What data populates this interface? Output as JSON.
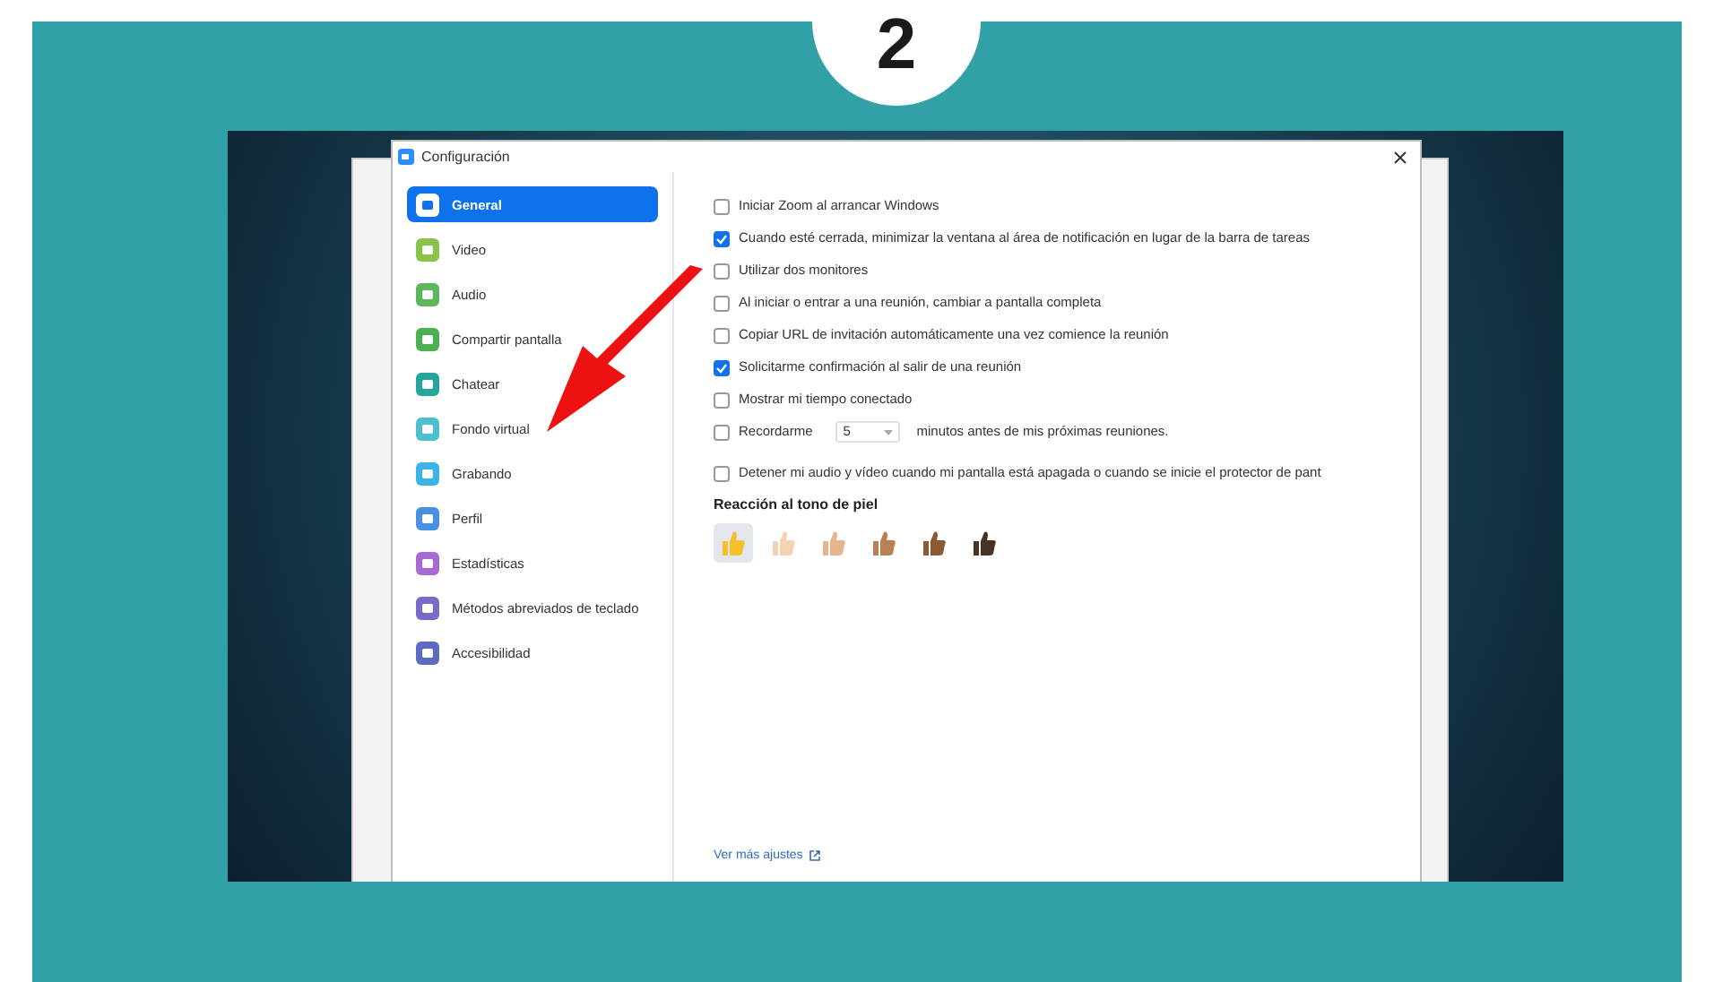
{
  "step_badge": "2",
  "window": {
    "title": "Configuración"
  },
  "sidebar": {
    "items": [
      {
        "label": "General",
        "selected": true,
        "color": "#ffffff"
      },
      {
        "label": "Video",
        "selected": false,
        "color": "#8bc34a"
      },
      {
        "label": "Audio",
        "selected": false,
        "color": "#5cb85c"
      },
      {
        "label": "Compartir pantalla",
        "selected": false,
        "color": "#4caf50"
      },
      {
        "label": "Chatear",
        "selected": false,
        "color": "#26a69a"
      },
      {
        "label": "Fondo virtual",
        "selected": false,
        "color": "#4dc0d0"
      },
      {
        "label": "Grabando",
        "selected": false,
        "color": "#3cb4e6"
      },
      {
        "label": "Perfil",
        "selected": false,
        "color": "#4a90e2"
      },
      {
        "label": "Estadísticas",
        "selected": false,
        "color": "#a66bd3"
      },
      {
        "label": "Métodos abreviados de teclado",
        "selected": false,
        "color": "#7b6bc9"
      },
      {
        "label": "Accesibilidad",
        "selected": false,
        "color": "#5c6bc0"
      }
    ]
  },
  "options": [
    {
      "kind": "checkbox",
      "label": "Iniciar Zoom al arrancar Windows",
      "checked": false
    },
    {
      "kind": "checkbox",
      "label": "Cuando esté cerrada, minimizar la ventana al área de notificación en lugar de la barra de tareas",
      "checked": true
    },
    {
      "kind": "checkbox",
      "label": "Utilizar dos monitores",
      "checked": false
    },
    {
      "kind": "checkbox",
      "label": "Al iniciar o entrar a una reunión, cambiar a pantalla completa",
      "checked": false
    },
    {
      "kind": "checkbox",
      "label": "Copiar URL de invitación automáticamente una vez comience la reunión",
      "checked": false
    },
    {
      "kind": "checkbox",
      "label": "Solicitarme confirmación al salir de una reunión",
      "checked": true
    },
    {
      "kind": "checkbox",
      "label": "Mostrar mi tiempo conectado",
      "checked": false
    },
    {
      "kind": "reminder",
      "label": "Recordarme",
      "value": "5",
      "suffix": "minutos antes de mis próximas reuniones.",
      "checked": false
    },
    {
      "kind": "checkbox",
      "label": "Detener mi audio y vídeo cuando mi pantalla está apagada o cuando se inicie el protector de pant",
      "checked": false
    }
  ],
  "skin_tone": {
    "heading": "Reacción al tono de piel",
    "tones": [
      {
        "color": "#f5c02a",
        "selected": true
      },
      {
        "color": "#f6d3b0",
        "selected": false
      },
      {
        "color": "#e6b48f",
        "selected": false
      },
      {
        "color": "#b97f55",
        "selected": false
      },
      {
        "color": "#8a5a35",
        "selected": false
      },
      {
        "color": "#4a3222",
        "selected": false
      }
    ]
  },
  "more_settings_link": "Ver más ajustes"
}
